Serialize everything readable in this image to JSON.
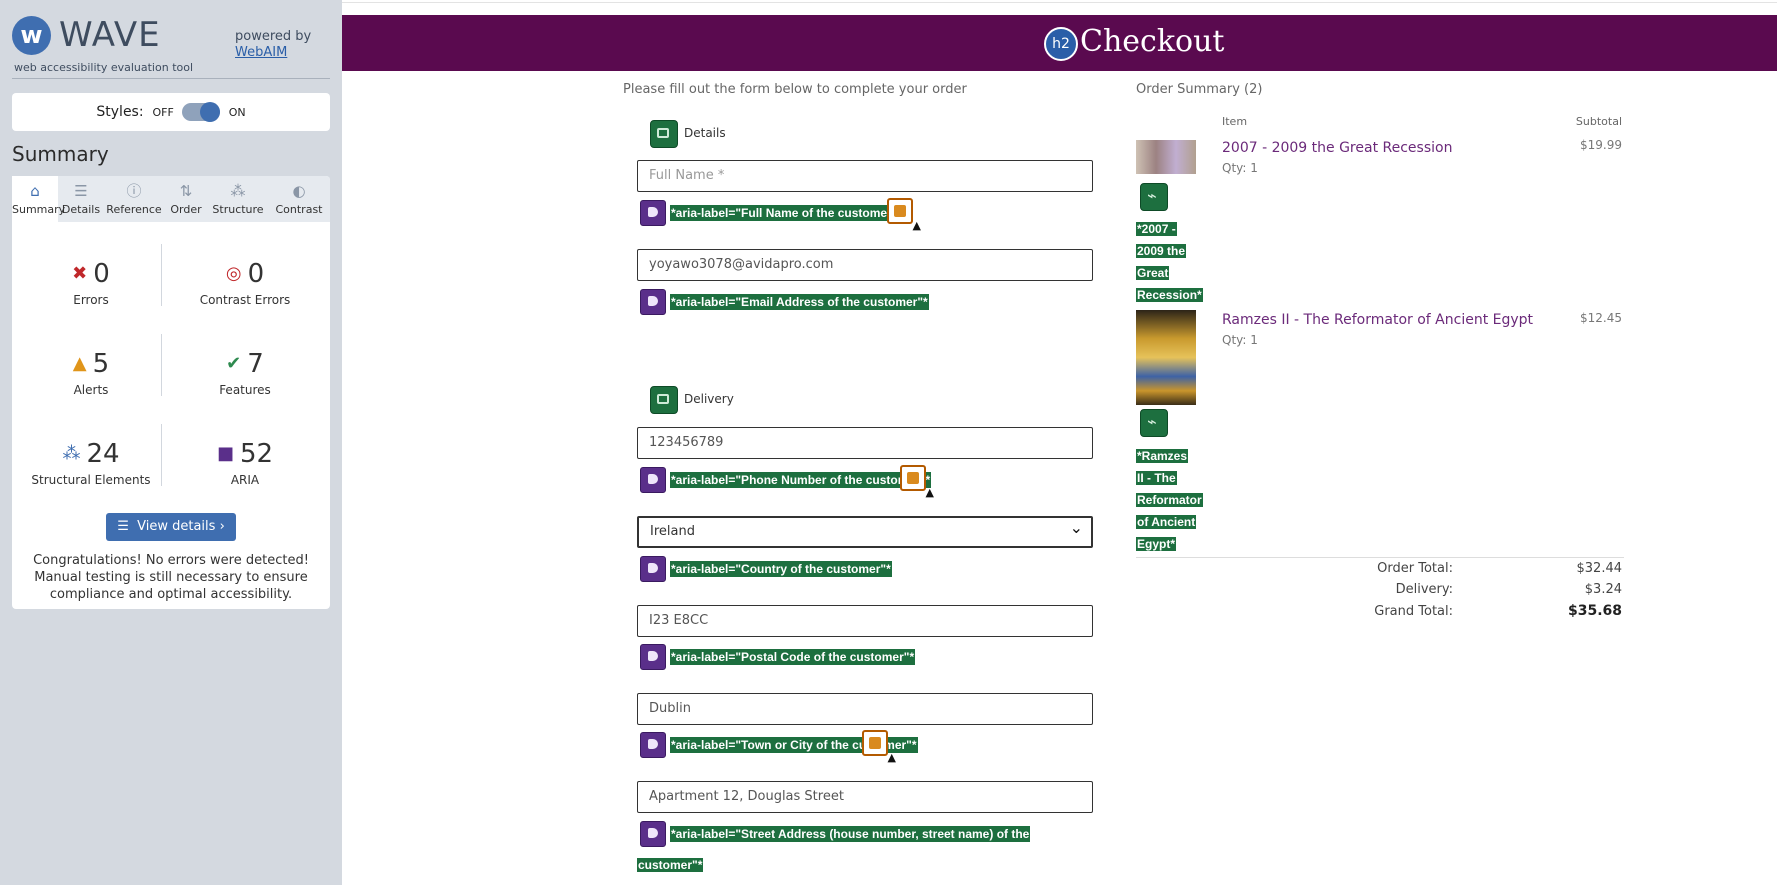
{
  "wave": {
    "logo_letter": "w",
    "logo_word": "WAVE",
    "logo_sub": "web accessibility evaluation tool",
    "powered_by": "powered by",
    "powered_link": "WebAIM",
    "styles_label": "Styles:",
    "styles_off": "OFF",
    "styles_on": "ON",
    "summary_heading": "Summary",
    "tabs": [
      {
        "label": "Summary",
        "icon": "home-icon"
      },
      {
        "label": "Details",
        "icon": "list-icon"
      },
      {
        "label": "Reference",
        "icon": "info-icon"
      },
      {
        "label": "Order",
        "icon": "order-icon"
      },
      {
        "label": "Structure",
        "icon": "structure-icon"
      },
      {
        "label": "Contrast",
        "icon": "contrast-icon"
      }
    ],
    "stats": {
      "errors": {
        "value": "0",
        "label": "Errors"
      },
      "contrast_errors": {
        "value": "0",
        "label": "Contrast Errors"
      },
      "alerts": {
        "value": "5",
        "label": "Alerts"
      },
      "features": {
        "value": "7",
        "label": "Features"
      },
      "structural": {
        "value": "24",
        "label": "Structural Elements"
      },
      "aria": {
        "value": "52",
        "label": "ARIA"
      }
    },
    "view_details": "View details ›",
    "congrats": "Congratulations! No errors were detected! Manual testing is still necessary to ensure compliance and optimal accessibility."
  },
  "page": {
    "h2_badge": "h2",
    "title": "Checkout",
    "lead": "Please fill out the form below to complete your order",
    "section_details": "Details",
    "section_delivery": "Delivery",
    "fields": {
      "full_name_placeholder": "Full Name *",
      "email_value": "yoyawo3078@avidapro.com",
      "phone_value": "123456789",
      "country_value": "Ireland",
      "postal_value": "I23 E8CC",
      "town_value": "Dublin",
      "street_value": "Apartment 12, Douglas Street"
    },
    "aria": {
      "full_name": "*aria-label=\"Full Name of the customer\"*",
      "email": "*aria-label=\"Email Address of the customer\"*",
      "phone": "*aria-label=\"Phone Number of the customer\"*",
      "country": "*aria-label=\"Country of the customer\"*",
      "postal": "*aria-label=\"Postal Code of the customer\"*",
      "town": "*aria-label=\"Town or City of the customer\"*",
      "street_line1": "*aria-label=\"Street Address (house number, street name) of the",
      "street_line2": "customer\"*"
    }
  },
  "order": {
    "title": "Order Summary (2)",
    "col_item": "Item",
    "col_subtotal": "Subtotal",
    "items": [
      {
        "name": "2007 - 2009 the Great Recession",
        "qty": "Qty: 1",
        "price": "$19.99",
        "alt_lines": [
          "*2007 -",
          "2009 the",
          "Great",
          "Recession*"
        ]
      },
      {
        "name": "Ramzes II - The Reformator of Ancient Egypt",
        "qty": "Qty: 1",
        "price": "$12.45",
        "alt_lines": [
          "*Ramzes",
          "II - The",
          "Reformator",
          "of Ancient",
          "Egypt*"
        ]
      }
    ],
    "totals": {
      "order_total_label": "Order Total:",
      "order_total": "$32.44",
      "delivery_label": "Delivery:",
      "delivery": "$3.24",
      "grand_total_label": "Grand Total:",
      "grand_total": "$35.68"
    }
  },
  "colors": {
    "header_bg": "#5a0a4f",
    "wave_blue": "#3f6eb0",
    "aria_green": "#1d6f3f",
    "aria_purple": "#5a2f8a",
    "alert_orange": "#b35a00"
  }
}
